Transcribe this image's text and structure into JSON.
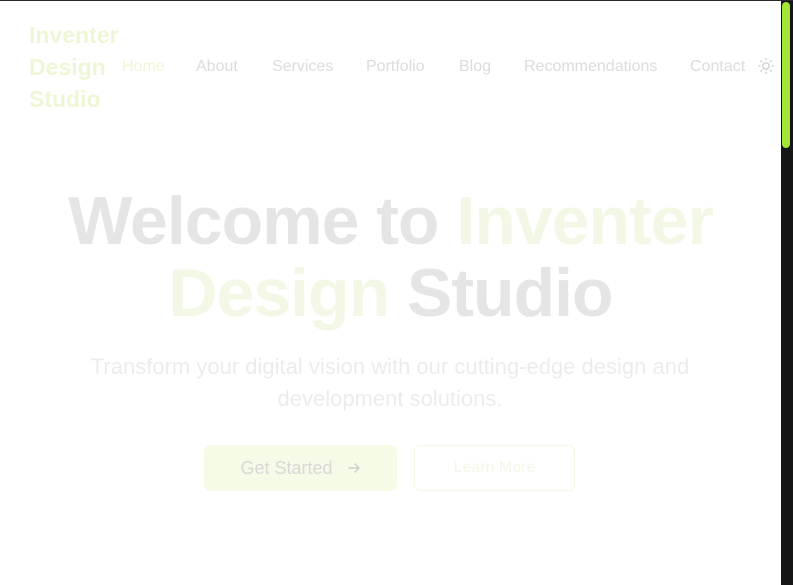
{
  "brand": {
    "logo_lines": [
      "Inventer",
      "Design",
      "Studio"
    ]
  },
  "nav": {
    "items": [
      {
        "label": "Home"
      },
      {
        "label": "About"
      },
      {
        "label": "Services"
      },
      {
        "label": "Portfolio"
      },
      {
        "label": "Blog"
      },
      {
        "label": "Recommendations"
      },
      {
        "label": "Contact"
      }
    ],
    "theme_icon": "sun-icon"
  },
  "hero": {
    "title_line1_plain": "Welcome to",
    "title_line1_accent": "Inventer",
    "title_line2_accent": "Design",
    "title_line2_plain": "Studio",
    "subtitle": "Transform your digital vision with our cutting-edge design and development solutions.",
    "primary_cta": "Get Started",
    "primary_cta_icon": "arrow-right-icon",
    "secondary_cta": "Learn More"
  },
  "colors": {
    "accent": "#a3e635",
    "background": "#ffffff"
  }
}
